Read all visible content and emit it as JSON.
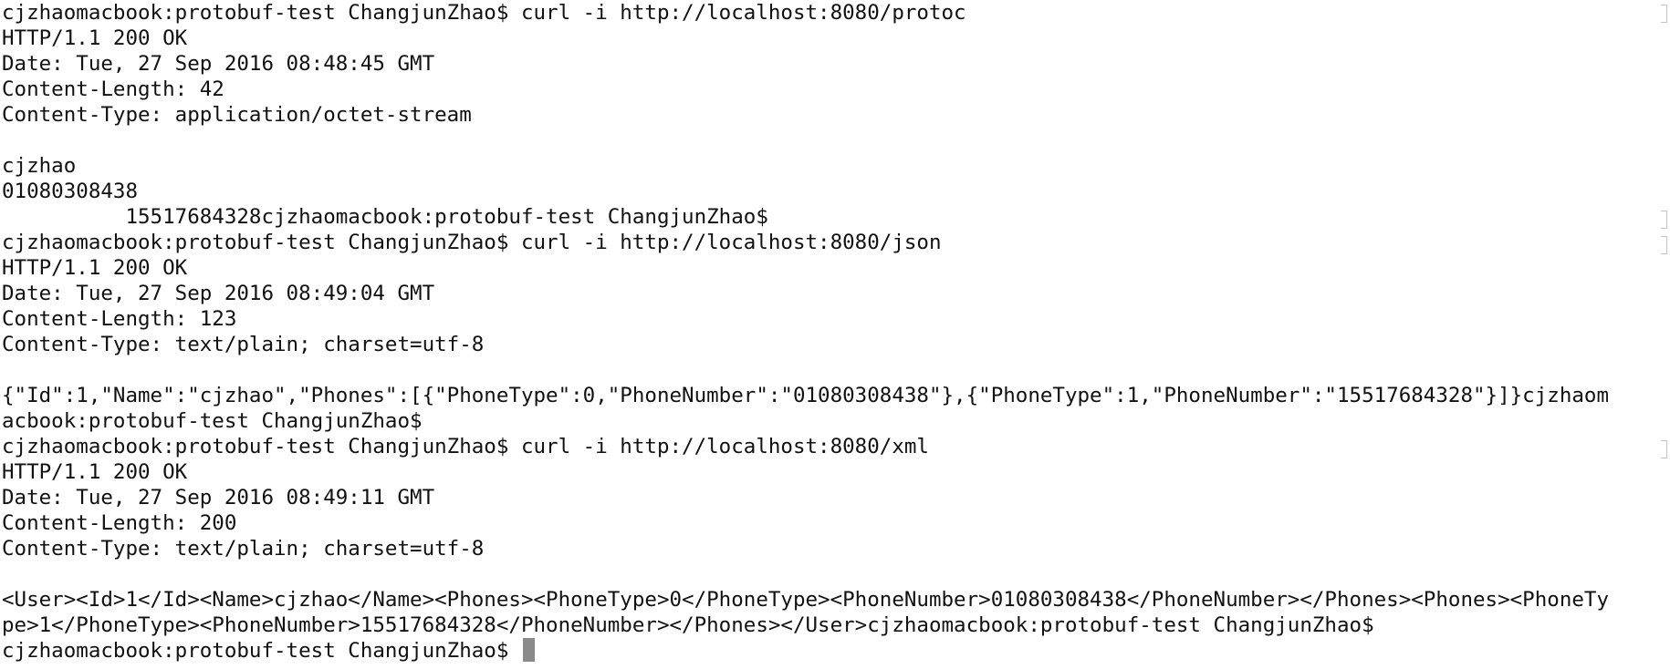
{
  "terminal": {
    "lines": [
      "cjzhaomacbook:protobuf-test ChangjunZhao$ curl -i http://localhost:8080/protoc",
      "HTTP/1.1 200 OK",
      "Date: Tue, 27 Sep 2016 08:48:45 GMT",
      "Content-Length: 42",
      "Content-Type: application/octet-stream",
      "",
      "cjzhao",
      "01080308438",
      "          15517684328cjzhaomacbook:protobuf-test ChangjunZhao$",
      "cjzhaomacbook:protobuf-test ChangjunZhao$ curl -i http://localhost:8080/json",
      "HTTP/1.1 200 OK",
      "Date: Tue, 27 Sep 2016 08:49:04 GMT",
      "Content-Length: 123",
      "Content-Type: text/plain; charset=utf-8",
      "",
      "{\"Id\":1,\"Name\":\"cjzhao\",\"Phones\":[{\"PhoneType\":0,\"PhoneNumber\":\"01080308438\"},{\"PhoneType\":1,\"PhoneNumber\":\"15517684328\"}]}cjzhaom",
      "acbook:protobuf-test ChangjunZhao$",
      "cjzhaomacbook:protobuf-test ChangjunZhao$ curl -i http://localhost:8080/xml",
      "HTTP/1.1 200 OK",
      "Date: Tue, 27 Sep 2016 08:49:11 GMT",
      "Content-Length: 200",
      "Content-Type: text/plain; charset=utf-8",
      "",
      "<User><Id>1</Id><Name>cjzhao</Name><Phones><PhoneType>0</PhoneType><PhoneNumber>01080308438</PhoneNumber></Phones><Phones><PhoneTy",
      "pe>1</PhoneType><PhoneNumber>15517684328</PhoneNumber></Phones></User>cjzhaomacbook:protobuf-test ChangjunZhao$",
      "cjzhaomacbook:protobuf-test ChangjunZhao$ "
    ],
    "colors": {
      "background": "#ffffff",
      "text": "#111111",
      "cursor": "#8a8a8a"
    }
  }
}
